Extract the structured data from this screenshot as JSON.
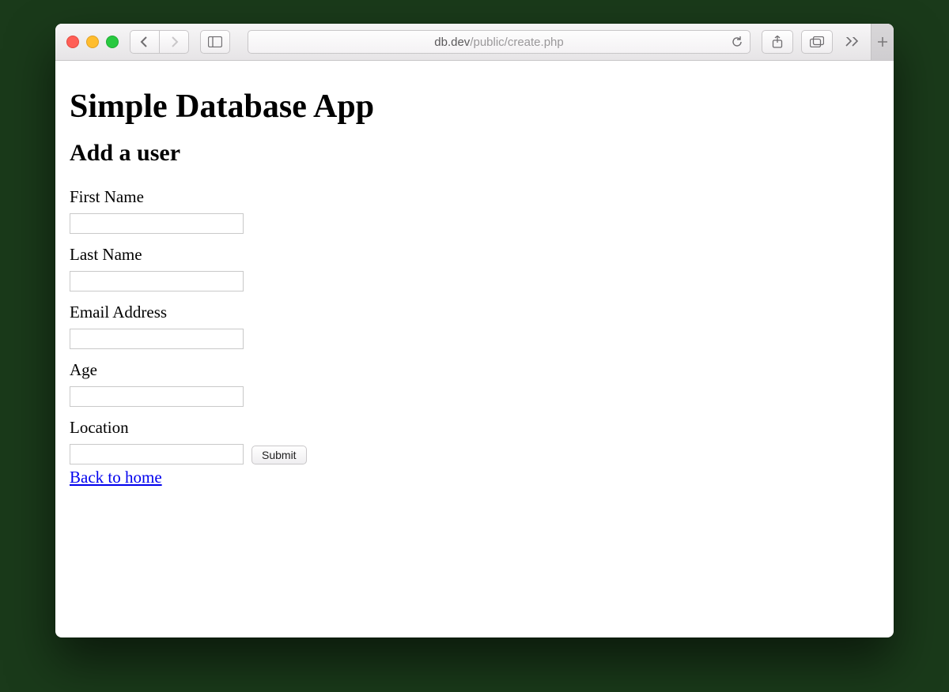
{
  "browser": {
    "url_host": "db.dev",
    "url_path": "/public/create.php"
  },
  "page": {
    "title": "Simple Database App",
    "subtitle": "Add a user",
    "fields": {
      "first_name": {
        "label": "First Name",
        "value": ""
      },
      "last_name": {
        "label": "Last Name",
        "value": ""
      },
      "email": {
        "label": "Email Address",
        "value": ""
      },
      "age": {
        "label": "Age",
        "value": ""
      },
      "location": {
        "label": "Location",
        "value": ""
      }
    },
    "submit_label": "Submit",
    "back_link_label": "Back to home"
  }
}
